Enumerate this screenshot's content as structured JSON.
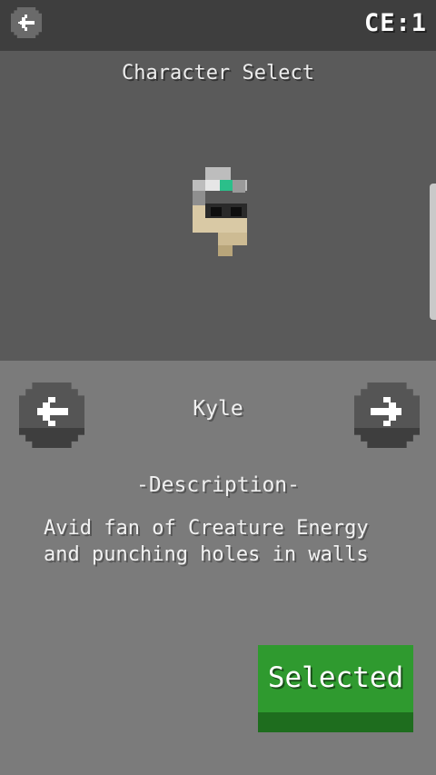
{
  "header": {
    "back_icon": "arrow-left-icon",
    "ce_label": "CE:1"
  },
  "stage": {
    "title": "Character Select"
  },
  "character": {
    "name": "Kyle",
    "description_heading": "-Description-",
    "description": "Avid fan of Creature Energy and punching holes in walls",
    "prev_icon": "arrow-left-icon",
    "next_icon": "arrow-right-icon"
  },
  "action": {
    "select_label": "Selected"
  },
  "colors": {
    "accent_green": "#2f9a2f",
    "topbar": "#3e3e3e",
    "stage": "#5a5a5a",
    "panel": "#7b7b7b"
  }
}
